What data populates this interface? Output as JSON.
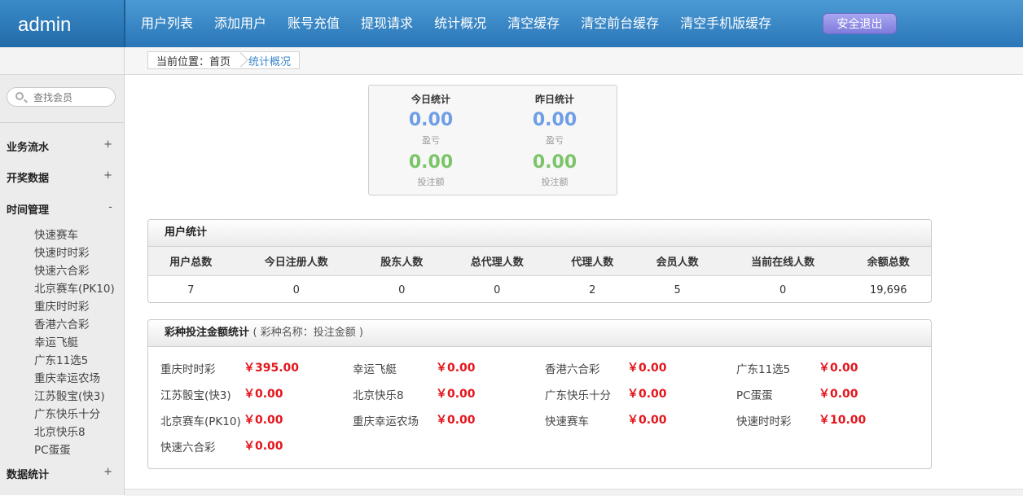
{
  "header": {
    "logo": "admin",
    "nav": [
      "用户列表",
      "添加用户",
      "账号充值",
      "提现请求",
      "统计概况",
      "清空缓存",
      "清空前台缓存",
      "清空手机版缓存"
    ],
    "logout": "安全退出"
  },
  "sidebar": {
    "search_placeholder": "查找会员",
    "sections": [
      {
        "label": "业务流水",
        "toggle": "+"
      },
      {
        "label": "开奖数据",
        "toggle": "+"
      },
      {
        "label": "时间管理",
        "toggle": "-"
      },
      {
        "label": "数据统计",
        "toggle": "+"
      }
    ],
    "sub_items": [
      "快速赛车",
      "快速时时彩",
      "快速六合彩",
      "北京赛车(PK10)",
      "重庆时时彩",
      "香港六合彩",
      "幸运飞艇",
      "广东11选5",
      "重庆幸运农场",
      "江苏骰宝(快3)",
      "广东快乐十分",
      "北京快乐8",
      "PC蛋蛋"
    ]
  },
  "breadcrumb": {
    "location": "当前位置：首页",
    "current": "统计概况"
  },
  "stats": {
    "today": {
      "title": "今日统计",
      "profit": "0.00",
      "profit_label": "盈亏",
      "bet": "0.00",
      "bet_label": "投注额"
    },
    "yesterday": {
      "title": "昨日统计",
      "profit": "0.00",
      "profit_label": "盈亏",
      "bet": "0.00",
      "bet_label": "投注额"
    }
  },
  "user_stats": {
    "title": "用户统计",
    "headers": [
      "用户总数",
      "今日注册人数",
      "股东人数",
      "总代理人数",
      "代理人数",
      "会员人数",
      "当前在线人数",
      "余额总数"
    ],
    "values": [
      "7",
      "0",
      "0",
      "0",
      "2",
      "5",
      "0",
      "19,696"
    ]
  },
  "bet_stats": {
    "title": "彩种投注金额统计",
    "subtitle": "( 彩种名称：投注金额 )",
    "items": [
      {
        "name": "重庆时时彩",
        "amount": "￥395.00"
      },
      {
        "name": "幸运飞艇",
        "amount": "￥0.00"
      },
      {
        "name": "香港六合彩",
        "amount": "￥0.00"
      },
      {
        "name": "广东11选5",
        "amount": "￥0.00"
      },
      {
        "name": "江苏骰宝(快3)",
        "amount": "￥0.00"
      },
      {
        "name": "北京快乐8",
        "amount": "￥0.00"
      },
      {
        "name": "广东快乐十分",
        "amount": "￥0.00"
      },
      {
        "name": "PC蛋蛋",
        "amount": "￥0.00"
      },
      {
        "name": "北京赛车(PK10)",
        "amount": "￥0.00"
      },
      {
        "name": "重庆幸运农场",
        "amount": "￥0.00"
      },
      {
        "name": "快速赛车",
        "amount": "￥0.00"
      },
      {
        "name": "快速时时彩",
        "amount": "￥10.00"
      },
      {
        "name": "快速六合彩",
        "amount": "￥0.00"
      }
    ]
  },
  "colors": {
    "header": "#2a76b8",
    "profit": "#6e9ee6",
    "bet": "#7cc46a",
    "amount": "#e3161c",
    "logout": "#7f7bdc"
  }
}
